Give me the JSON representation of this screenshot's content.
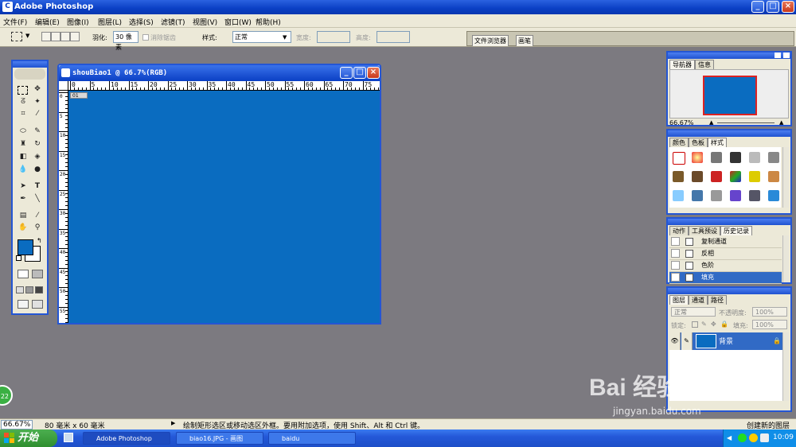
{
  "app": {
    "title": "Adobe Photoshop",
    "icon_letter": "C"
  },
  "window_controls": {
    "minimize": "_",
    "maximize": "□",
    "close": "×"
  },
  "menu": [
    "文件(F)",
    "编辑(E)",
    "图像(I)",
    "图层(L)",
    "选择(S)",
    "滤镜(T)",
    "视图(V)",
    "窗口(W)",
    "帮助(H)"
  ],
  "options": {
    "feather_label": "羽化:",
    "feather_value": "30 像素",
    "antialias_label": "消除锯齿",
    "style_label": "样式:",
    "style_value": "正常",
    "width_label": "宽度:",
    "height_label": "高度:",
    "tab_browser": "文件浏览器",
    "tab_brush": "画笔"
  },
  "document": {
    "title": "shouBiao1 @ 66.7%(RGB)",
    "layer_marker": "01",
    "ruler_h": [
      "0",
      "5",
      "10",
      "15",
      "20",
      "25",
      "30",
      "35",
      "40",
      "45",
      "50",
      "55",
      "60",
      "65",
      "70",
      "75"
    ],
    "ruler_v": [
      "0",
      "5",
      "10",
      "15",
      "20",
      "25",
      "30",
      "35",
      "40",
      "45",
      "50",
      "55",
      "60"
    ],
    "canvas_color": "#0a6cc0"
  },
  "navigator": {
    "tabs": [
      "导航器",
      "信息"
    ],
    "zoom": "66.67%"
  },
  "swatches_panel": {
    "tabs": [
      "颜色",
      "色板",
      "样式"
    ]
  },
  "history_panel": {
    "tabs": [
      "动作",
      "工具预设",
      "历史记录"
    ],
    "items": [
      "复制通道",
      "反相",
      "色阶",
      "填充"
    ],
    "selected": "填充"
  },
  "layers_panel": {
    "tabs": [
      "图层",
      "通道",
      "路径"
    ],
    "blend_mode": "正常",
    "opacity_label": "不透明度:",
    "opacity_value": "100%",
    "lock_label": "锁定:",
    "fill_label": "填充:",
    "fill_value": "100%",
    "layer_name": "背景"
  },
  "status": {
    "zoom": "66.67%",
    "doc_size": "80 毫米 x 60 毫米",
    "hint": "绘制矩形选区或移动选区外框。要用附加选项，使用 Shift、Alt 和 Ctrl 键。",
    "new_layer_tip": "创建新的图层"
  },
  "taskbar": {
    "start": "开始",
    "buttons": [
      "Adobe Photoshop",
      "biao16.JPG - 画图",
      "baidu"
    ],
    "clock": "10:09"
  },
  "watermark": {
    "text": "Bai 经验",
    "url": "jingyan.baidu.com"
  },
  "badge": "22"
}
